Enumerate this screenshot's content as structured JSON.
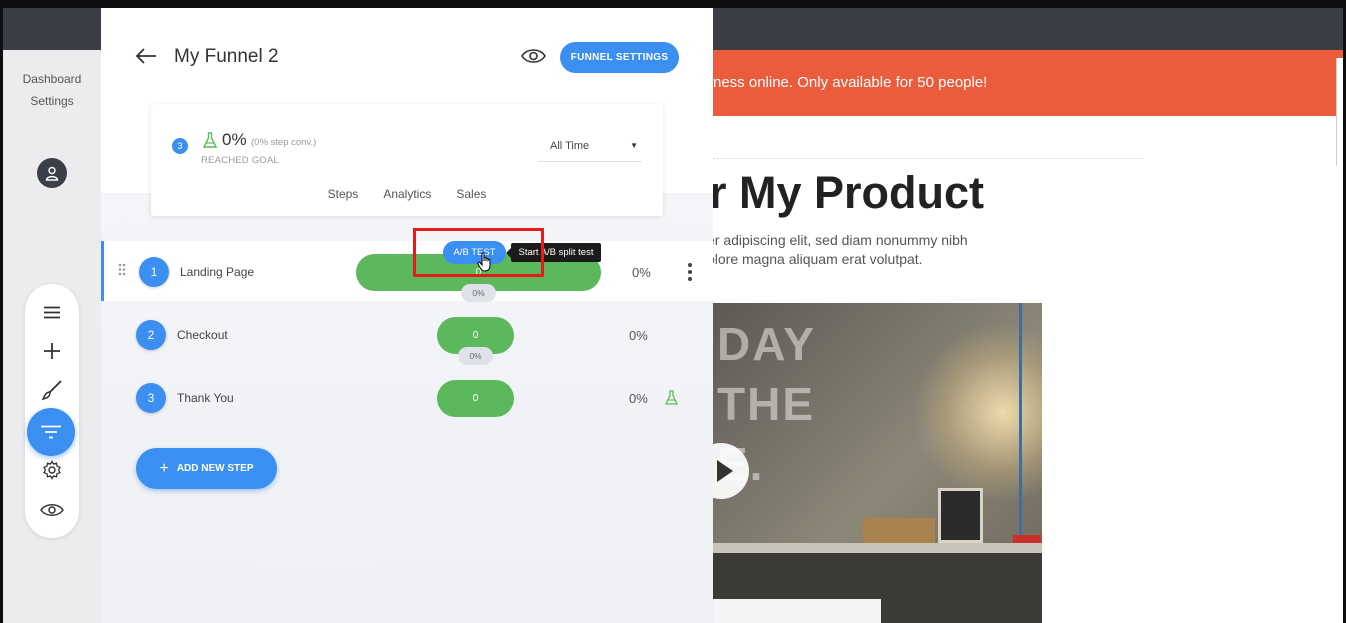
{
  "colors": {
    "accent": "#3b8ff0",
    "success": "#5cb85c",
    "promo": "#ea5c3c",
    "highlight": "#e81919"
  },
  "leftrail": {
    "links": [
      "Dashboard",
      "Settings"
    ],
    "avatar_icon": "user-icon",
    "tools": [
      "menu-icon",
      "plus-icon",
      "brush-icon",
      "funnel-icon",
      "gear-icon",
      "eye-icon"
    ],
    "active_tool": "funnel-icon"
  },
  "header": {
    "title": "My Funnel 2",
    "preview_icon": "eye-icon",
    "settings_button": "FUNNEL SETTINGS"
  },
  "stats": {
    "steps_count": "3",
    "percent": "0%",
    "step_conv": "(0% step conv.)",
    "reached_label": "REACHED GOAL",
    "range": "All Time",
    "tabs": [
      "Steps",
      "Analytics",
      "Sales"
    ]
  },
  "steps": [
    {
      "num": "1",
      "name": "Landing Page",
      "bar_value": "0",
      "conv": "0%",
      "pct": "0%"
    },
    {
      "num": "2",
      "name": "Checkout",
      "bar_value": "0",
      "conv": "0%",
      "pct": "0%"
    },
    {
      "num": "3",
      "name": "Thank You",
      "bar_value": "0",
      "conv": "",
      "pct": "0%"
    }
  ],
  "ab_test": {
    "label": "A/B TEST",
    "tooltip": "Start A/B split test"
  },
  "add_step": "ADD NEW STEP",
  "preview": {
    "promo": "ness online. Only available for 50 people!",
    "headline": "r My Product",
    "body_lines": [
      "er adipiscing elit, sed diam nonummy nibh",
      "olore magna aliquam erat volutpat."
    ],
    "photo_text": [
      "DAY",
      "THE",
      "E."
    ]
  }
}
